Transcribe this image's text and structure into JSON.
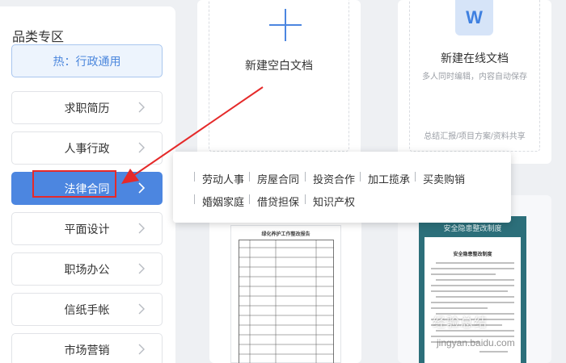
{
  "sidebar": {
    "title": "品类专区",
    "hot_item": "热：行政通用",
    "items": [
      {
        "label": "求职简历"
      },
      {
        "label": "人事行政"
      },
      {
        "label": "法律合同"
      },
      {
        "label": "平面设计"
      },
      {
        "label": "职场办公"
      },
      {
        "label": "信纸手帐"
      },
      {
        "label": "市场营销"
      }
    ],
    "active_item": "法律合同"
  },
  "cards": {
    "new_blank": {
      "title": "新建空白文档",
      "icon": "plus-icon"
    },
    "new_online": {
      "title": "新建在线文档",
      "subtitle": "多人同时编辑，内容自动保存",
      "tags": "总结汇报/项目方案/资料共享",
      "icon_letter": "W"
    }
  },
  "submenu": {
    "row1": [
      "劳动人事",
      "房屋合同",
      "投资合作",
      "加工揽承",
      "买卖购销"
    ],
    "row2": [
      "婚姻家庭",
      "借贷担保",
      "知识产权"
    ]
  },
  "templates": {
    "doc1_title": "绿化养护工作整改报告",
    "doc2_header": "安全隐患整改制度",
    "doc2_subtitle": "安全隐患整改制度"
  },
  "watermark": {
    "text": "经验总结",
    "url": "jingyan.baidu.com"
  },
  "colors": {
    "accent": "#4c86e0",
    "annotation": "#e52a2a"
  }
}
